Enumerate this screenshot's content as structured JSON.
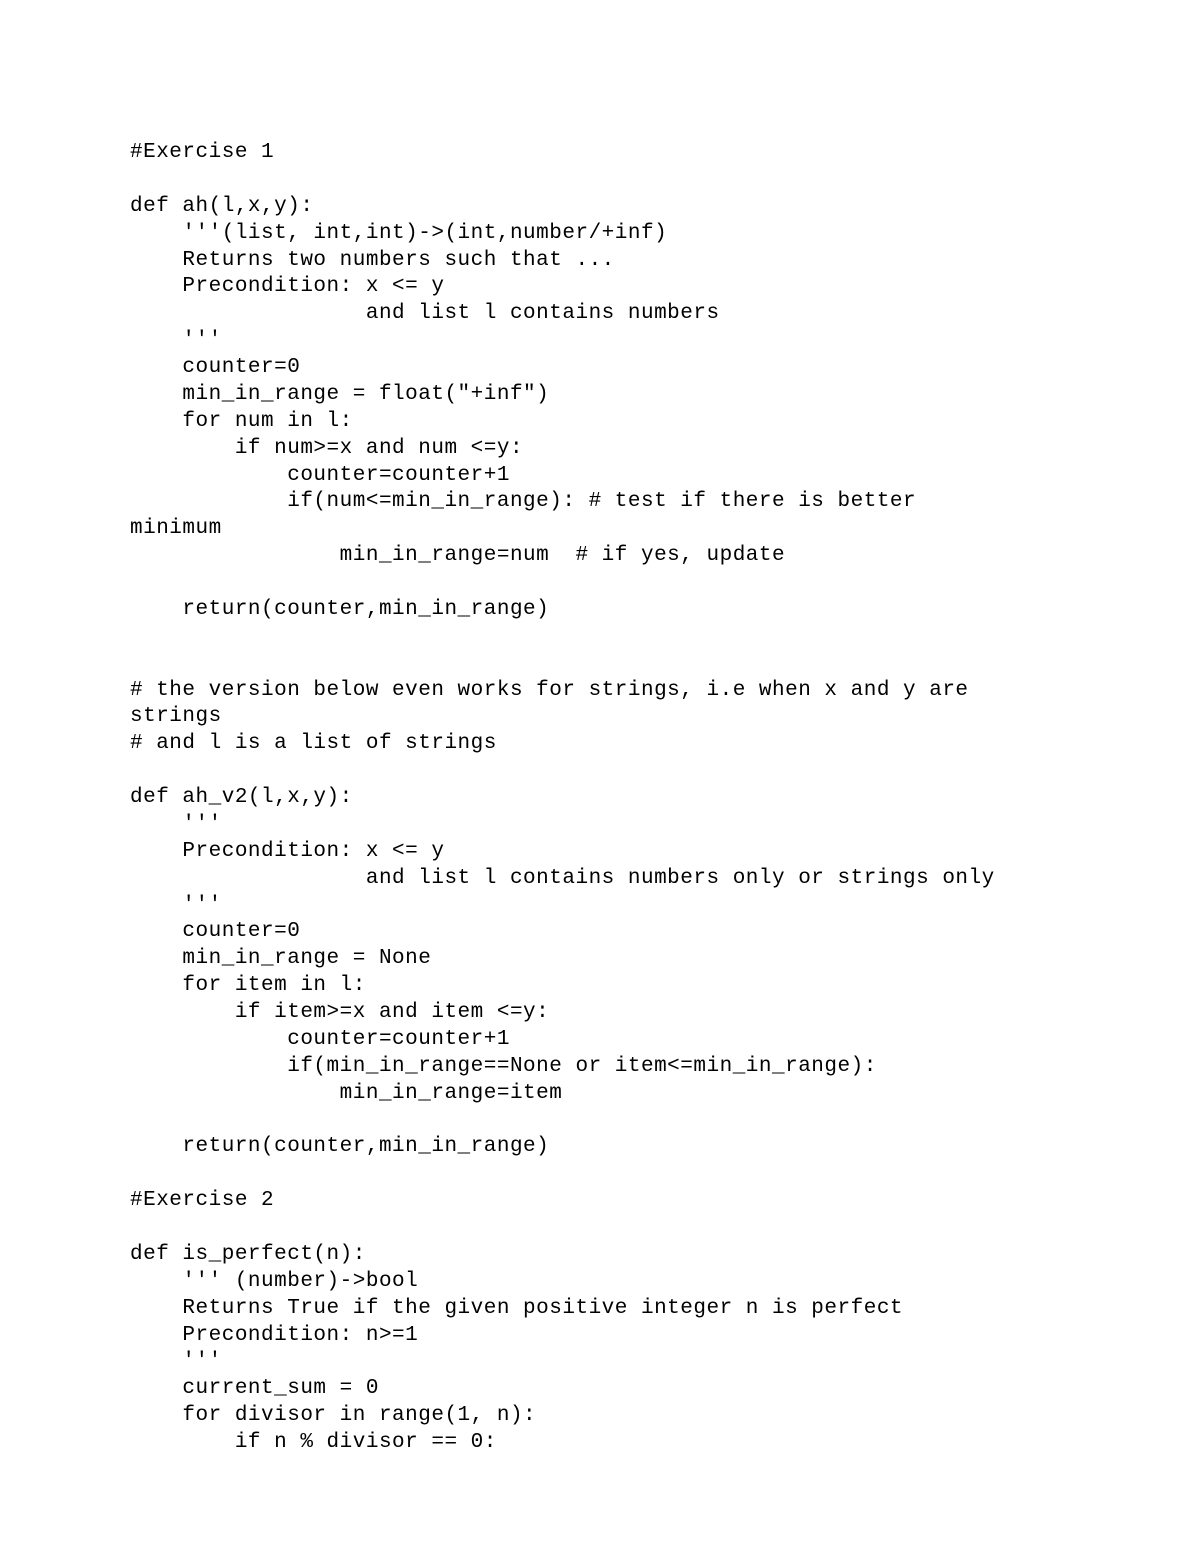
{
  "lines": [
    "#Exercise 1",
    "",
    "def ah(l,x,y):",
    "    '''(list, int,int)->(int,number/+inf)",
    "    Returns two numbers such that ...",
    "    Precondition: x <= y",
    "                  and list l contains numbers",
    "    '''",
    "    counter=0",
    "    min_in_range = float(\"+inf\")",
    "    for num in l:",
    "        if num>=x and num <=y:",
    "            counter=counter+1",
    "            if(num<=min_in_range): # test if there is better",
    "minimum",
    "                min_in_range=num  # if yes, update",
    "",
    "    return(counter,min_in_range)",
    "",
    "",
    "# the version below even works for strings, i.e when x and y are",
    "strings",
    "# and l is a list of strings",
    "",
    "def ah_v2(l,x,y):",
    "    '''",
    "    Precondition: x <= y",
    "                  and list l contains numbers only or strings only",
    "    '''",
    "    counter=0",
    "    min_in_range = None",
    "    for item in l:",
    "        if item>=x and item <=y:",
    "            counter=counter+1",
    "            if(min_in_range==None or item<=min_in_range):",
    "                min_in_range=item",
    "",
    "    return(counter,min_in_range)",
    "",
    "#Exercise 2",
    "",
    "def is_perfect(n):",
    "    ''' (number)->bool",
    "    Returns True if the given positive integer n is perfect",
    "    Precondition: n>=1",
    "    '''",
    "    current_sum = 0",
    "    for divisor in range(1, n):",
    "        if n % divisor == 0:"
  ]
}
